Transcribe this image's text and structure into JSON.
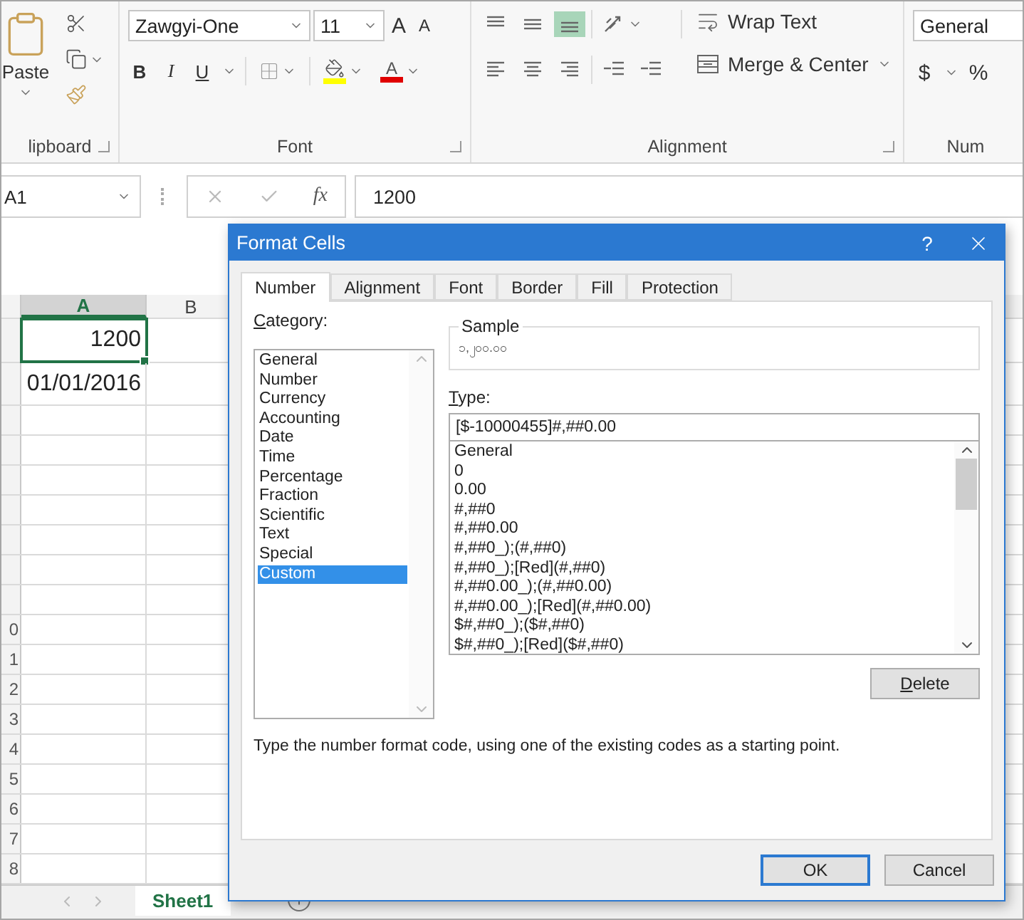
{
  "ribbon": {
    "clipboard": {
      "paste": "Paste",
      "group_label": "lipboard"
    },
    "font": {
      "name": "Zawgyi-One",
      "size": "11",
      "grow": "A",
      "shrink": "A",
      "bold": "B",
      "italic": "I",
      "underline": "U",
      "font_color": "A",
      "group_label": "Font"
    },
    "alignment": {
      "vertical": [
        {
          "kind": "top",
          "selected": false
        },
        {
          "kind": "middle",
          "selected": false
        },
        {
          "kind": "bottom",
          "selected": true
        }
      ],
      "wrap_text": "Wrap Text",
      "merge": "Merge & Center",
      "group_label": "Alignment"
    },
    "number": {
      "format": "General",
      "currency": "$",
      "percent": "%",
      "group_label": "Num"
    }
  },
  "formula_bar": {
    "name_box": "A1",
    "function_label": "fx",
    "value": "1200"
  },
  "sheet": {
    "columns": [
      {
        "label": "A",
        "selected": true
      },
      {
        "label": "B",
        "selected": false
      }
    ],
    "cells": [
      {
        "value": "1200",
        "selected": true
      },
      {
        "value": "01/01/2016",
        "selected": false
      }
    ],
    "row_labels": [
      "0",
      "1",
      "2",
      "3",
      "4",
      "5",
      "6",
      "7",
      "8"
    ],
    "sheet_tabs": [
      {
        "label": "Sheet1",
        "selected": true
      }
    ]
  },
  "dialog": {
    "title": "Format Cells",
    "help": "?",
    "tabs": [
      {
        "label": "Number",
        "selected": true
      },
      {
        "label": "Alignment",
        "selected": false
      },
      {
        "label": "Font",
        "selected": false
      },
      {
        "label": "Border",
        "selected": false
      },
      {
        "label": "Fill",
        "selected": false
      },
      {
        "label": "Protection",
        "selected": false
      }
    ],
    "category_label": "Category:",
    "categories": [
      {
        "label": "General",
        "selected": false
      },
      {
        "label": "Number",
        "selected": false
      },
      {
        "label": "Currency",
        "selected": false
      },
      {
        "label": "Accounting",
        "selected": false
      },
      {
        "label": "Date",
        "selected": false
      },
      {
        "label": "Time",
        "selected": false
      },
      {
        "label": "Percentage",
        "selected": false
      },
      {
        "label": "Fraction",
        "selected": false
      },
      {
        "label": "Scientific",
        "selected": false
      },
      {
        "label": "Text",
        "selected": false
      },
      {
        "label": "Special",
        "selected": false
      },
      {
        "label": "Custom",
        "selected": true
      }
    ],
    "sample_label": "Sample",
    "sample_value": "၁,၂၀၀.၀၀",
    "type_label": "Type:",
    "type_value": "[$-10000455]#,##0.00",
    "formats": [
      "General",
      "0",
      "0.00",
      "#,##0",
      "#,##0.00",
      "#,##0_);(#,##0)",
      "#,##0_);[Red](#,##0)",
      "#,##0.00_);(#,##0.00)",
      "#,##0.00_);[Red](#,##0.00)",
      "$#,##0_);($#,##0)",
      "$#,##0_);[Red]($#,##0)"
    ],
    "delete": "Delete",
    "description": "Type the number format code, using one of the existing codes as a starting point.",
    "ok": "OK",
    "cancel": "Cancel"
  }
}
